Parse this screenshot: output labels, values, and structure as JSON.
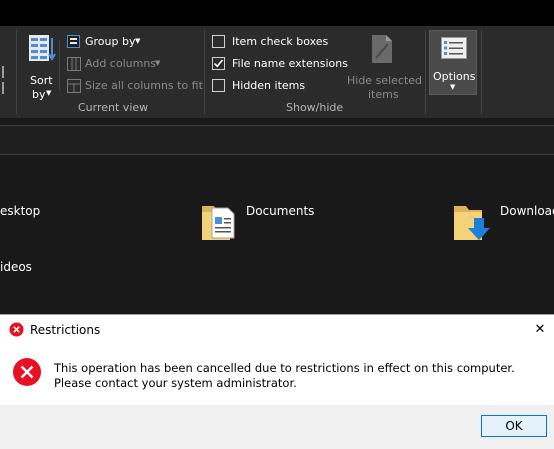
{
  "ribbon": {
    "sort_label_1": "Sort",
    "sort_label_2": "by",
    "group_by": "Group by",
    "add_columns": "Add columns",
    "size_all_columns": "Size all columns to fit",
    "current_view_label": "Current view",
    "item_check_boxes": "Item check boxes",
    "file_name_extensions": "File name extensions",
    "hidden_items": "Hidden items",
    "hide_selected_1": "Hide selected",
    "hide_selected_2": "items",
    "show_hide_label": "Show/hide",
    "options": "Options",
    "checks": {
      "item_check_boxes": false,
      "file_name_extensions": true,
      "hidden_items": false
    }
  },
  "content": {
    "items": [
      "esktop",
      "Documents",
      "Download",
      "ideos"
    ]
  },
  "dialog": {
    "title": "Restrictions",
    "message": "This operation has been cancelled due to restrictions in effect on this computer. Please contact your system administrator.",
    "ok": "OK",
    "close_glyph": "✕",
    "icon": "error-icon"
  },
  "colors": {
    "error_red": "#e81123",
    "accent_blue": "#0078d7"
  }
}
